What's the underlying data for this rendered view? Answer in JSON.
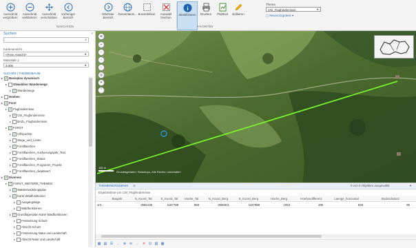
{
  "ribbon": {
    "buttons": [
      {
        "label": "Ausschnitt vergrößern",
        "icon": "zoom-in-icon"
      },
      {
        "label": "Ausschnitt verkleinern",
        "icon": "zoom-out-icon"
      },
      {
        "label": "Ausschnitt verschieben",
        "icon": "pan-icon"
      },
      {
        "label": "Vorheriger Bereich",
        "icon": "back-icon"
      },
      {
        "label": "Nächster Bereich",
        "icon": "forward-icon"
      },
      {
        "label": "Gesamtansi...",
        "icon": "globe-icon"
      },
      {
        "label": "Boxselektion",
        "icon": "box-select-icon"
      },
      {
        "label": "Auswahl löschen",
        "icon": "clear-selection-icon"
      },
      {
        "label": "Identifizieren",
        "icon": "info-icon"
      },
      {
        "label": "Drucken",
        "icon": "print-icon"
      },
      {
        "label": "Plotttool",
        "icon": "plot-icon"
      },
      {
        "label": "Editieren",
        "icon": "edit-icon"
      }
    ],
    "group_navigation": "NAVIGATION",
    "group_favoriten": "FAVORITEN",
    "thema_label": "Thema",
    "thema_value": "CW_Flughindernisse",
    "neues_ergebnis": "Neues Ergebnis"
  },
  "left": {
    "suchen_title": "Suchen",
    "kartenansicht_label": "Kartenansicht",
    "kartenansicht_value": "<Freie Ansicht>",
    "massstab_label": "Massstab 1:",
    "massstab_value": "3.000",
    "tabs": "SUCHEN | THEMENBAUM",
    "tree": [
      {
        "indent": 0,
        "text": "Basisplan dynamisch",
        "bold": true,
        "checked": true
      },
      {
        "indent": 1,
        "text": "Obwaldner Wanderwege",
        "bold": true,
        "checked": false
      },
      {
        "indent": 2,
        "text": "Wanderwege",
        "bold": false,
        "checked": true
      },
      {
        "indent": 0,
        "text": "Hoehen",
        "bold": true,
        "checked": false
      },
      {
        "indent": 0,
        "text": "Forst",
        "bold": true,
        "checked": true
      },
      {
        "indent": 1,
        "text": "Flughindernisse",
        "bold": false,
        "checked": true
      },
      {
        "indent": 2,
        "text": "CW_Flughindernisse",
        "bold": false,
        "checked": true
      },
      {
        "indent": 2,
        "text": "BAZL_Flughindernisse",
        "bold": false,
        "checked": false
      },
      {
        "indent": 1,
        "text": "FORST",
        "bold": false,
        "checked": true
      },
      {
        "indent": 2,
        "text": "Hilfspunkte",
        "bold": false,
        "checked": true
      },
      {
        "indent": 2,
        "text": "Wege_und_Linien",
        "bold": false,
        "checked": false
      },
      {
        "indent": 2,
        "text": "Forstflaechen",
        "bold": false,
        "checked": true
      },
      {
        "indent": 2,
        "text": "Forstflaechen_Ausfuerungsjahr_Text",
        "bold": false,
        "checked": false
      },
      {
        "indent": 2,
        "text": "Forstflaechen_Status",
        "bold": false,
        "checked": false
      },
      {
        "indent": 2,
        "text": "Forstflaechen_Programm_Projekt",
        "bold": false,
        "checked": false
      },
      {
        "indent": 2,
        "text": "Forstflaechen_deaktiviert",
        "bold": false,
        "checked": false
      },
      {
        "indent": 0,
        "text": "Diverses",
        "bold": true,
        "checked": true
      },
      {
        "indent": 1,
        "text": "FORST_WEITERE_THEMEN",
        "bold": false,
        "checked": true
      },
      {
        "indent": 2,
        "text": "Waldentwicklungsplan",
        "bold": false,
        "checked": true
      },
      {
        "indent": 2,
        "text": "Karte Waldfunktionen",
        "bold": false,
        "checked": true
      },
      {
        "indent": 3,
        "text": "Ausgangslage",
        "bold": false,
        "checked": false
      },
      {
        "indent": 3,
        "text": "Waldfunktionen",
        "bold": false,
        "checked": false
      },
      {
        "indent": 2,
        "text": "Grundlagenplan Karte Waldfunktionen",
        "bold": false,
        "checked": true
      },
      {
        "indent": 3,
        "text": "Festsetzung Schutz",
        "bold": false,
        "checked": false
      },
      {
        "indent": 3,
        "text": "Absicht Schutz",
        "bold": false,
        "checked": false
      },
      {
        "indent": 3,
        "text": "Festsetzung Natur und Landschaft",
        "bold": false,
        "checked": false
      },
      {
        "indent": 3,
        "text": "Absicht Natur und Landschaft",
        "bold": false,
        "checked": false
      }
    ]
  },
  "map": {
    "scale_text": "100 m",
    "attribution": "Grundlagedaten: Swisstopo; Alle Rechte vorbehalten"
  },
  "results": {
    "tab_label": "THEMENERGEBNIS",
    "selection_status": "0 von 0 Objekten ausgewählt",
    "subtitle": "Ergebnisliste von CW_Flughindernisse",
    "columns": [
      "Baujahr",
      "N_Koord_Tal",
      "E_Koord_Tal",
      "Hoehe_Tal",
      "N_Koord_Berg",
      "E_Koord_Berg",
      "Hoehe_Berg",
      "Hoehendifferenz",
      "Laenge_horizontal",
      "Bodendistanz"
    ],
    "row": {
      "prefix": "ont...",
      "Baujahr": "",
      "N_Koord_Tal": "2665135",
      "E_Koord_Tal": "1187788",
      "Hoehe_Tal": "858",
      "N_Koord_Berg": "2665841",
      "E_Koord_Berg": "1187988",
      "Hoehe_Berg": "1053",
      "Hoehendifferenz": "195",
      "Laenge_horizontal": "828",
      "Bodendistanz": "85"
    }
  }
}
